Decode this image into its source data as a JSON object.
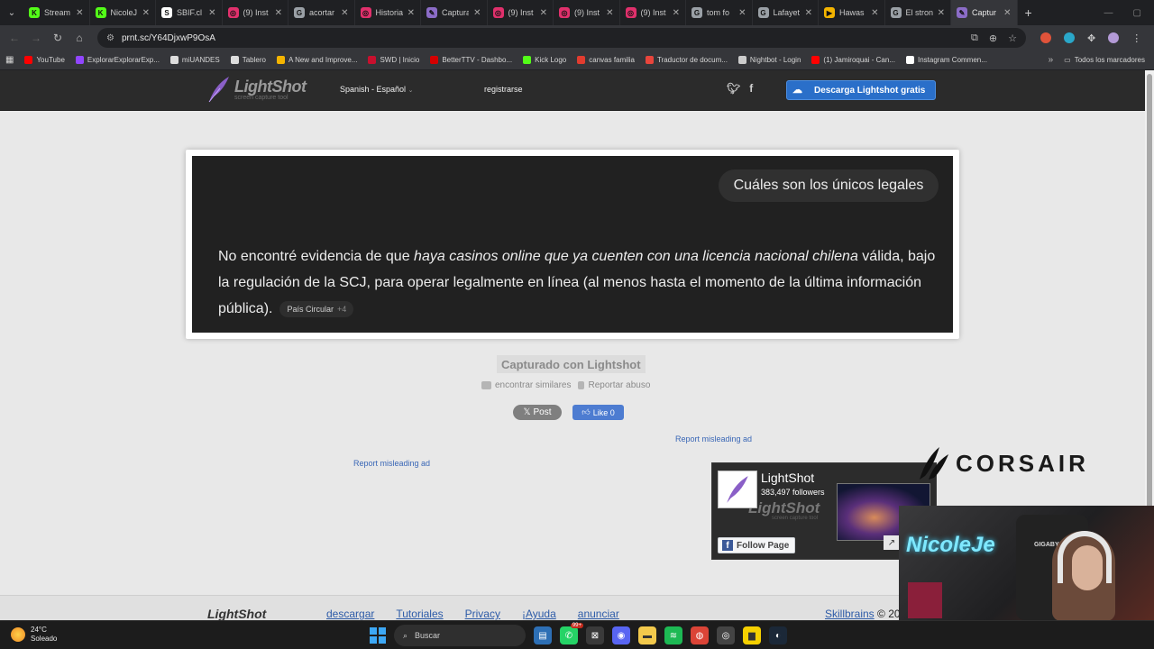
{
  "browser": {
    "tabs": [
      {
        "title": "Stream",
        "color": "#53fc18",
        "glyph": "K"
      },
      {
        "title": "NicoleJ",
        "color": "#53fc18",
        "glyph": "K"
      },
      {
        "title": "SBIF.cl",
        "color": "#ffffff",
        "glyph": "S"
      },
      {
        "title": "(9) Inst",
        "color": "#e1306c",
        "glyph": "◎"
      },
      {
        "title": "acortar",
        "color": "#9aa0a6",
        "glyph": "G"
      },
      {
        "title": "Historia",
        "color": "#e1306c",
        "glyph": "◎"
      },
      {
        "title": "Captura",
        "color": "#8b6cc7",
        "glyph": "✎"
      },
      {
        "title": "(9) Inst",
        "color": "#e1306c",
        "glyph": "◎"
      },
      {
        "title": "(9) Inst",
        "color": "#e1306c",
        "glyph": "◎"
      },
      {
        "title": "(9) Inst",
        "color": "#e1306c",
        "glyph": "◎"
      },
      {
        "title": "tom fo",
        "color": "#9aa0a6",
        "glyph": "G"
      },
      {
        "title": "Lafayet",
        "color": "#9aa0a6",
        "glyph": "G"
      },
      {
        "title": "Hawas",
        "color": "#f4b400",
        "glyph": "▶"
      },
      {
        "title": "El stron",
        "color": "#9aa0a6",
        "glyph": "G"
      },
      {
        "title": "Captur",
        "color": "#8b6cc7",
        "glyph": "✎"
      }
    ],
    "active_tab_index": 14,
    "url": "prnt.sc/Y64DjxwP9OsA",
    "bookmarks": [
      {
        "label": "YouTube",
        "color": "#ff0000"
      },
      {
        "label": "ExplorarExplorarExp...",
        "color": "#9146ff"
      },
      {
        "label": "miUANDES",
        "color": "#dddddd"
      },
      {
        "label": "Tablero",
        "color": "#dddddd"
      },
      {
        "label": "A New and Improve...",
        "color": "#f4b400"
      },
      {
        "label": "SWD | Inicio",
        "color": "#c8102e"
      },
      {
        "label": "BetterTTV - Dashbo...",
        "color": "#d50000"
      },
      {
        "label": "Kick Logo",
        "color": "#53fc18"
      },
      {
        "label": "canvas familia",
        "color": "#e13c2f"
      },
      {
        "label": "Traductor de docum...",
        "color": "#e8453c"
      },
      {
        "label": "Nightbot - Login",
        "color": "#cccccc"
      },
      {
        "label": "(1) Jamiroquai - Can...",
        "color": "#ff0000"
      },
      {
        "label": "Instagram Commen...",
        "color": "#ffffff"
      }
    ],
    "bookmarks_more": "»",
    "all_bookmarks": "Todos los marcadores"
  },
  "lightshot": {
    "logo_name": "LightShot",
    "logo_sub": "screen capture tool",
    "language": "Spanish - Español",
    "register": "registrarse",
    "download": "Descarga Lightshot gratis",
    "screenshot": {
      "question": "Cuáles son los únicos legales",
      "answer_plain_1": "No encontré evidencia de que ",
      "answer_italic": "haya casinos online que ya cuenten con una licencia nacional chilena",
      "answer_plain_2": " válida, bajo la regulación de la SCJ, para operar legalmente en línea (al menos hasta el momento de la última información pública).",
      "cite_label": "País Circular",
      "cite_more": "+4"
    },
    "captured": "Capturado con Lightshot",
    "find_similar": "encontrar similares",
    "report_abuse": "Reportar abuso",
    "post": "Post",
    "like": "Like 0",
    "report_ad_1": "Report misleading ad",
    "report_ad_2": "Report misleading ad",
    "fb": {
      "name": "LightShot",
      "followers": "383,497 followers",
      "bg_text": "LightShot",
      "bg_sub": "screen capture tool",
      "follow": "Follow Page"
    },
    "footer": {
      "logo": "LightShot",
      "links": [
        "descargar",
        "Tutoriales",
        "Privacy",
        "¡Ayuda",
        "anunciar"
      ],
      "company": "Skillbrains",
      "copyright": "© 20"
    }
  },
  "overlay": {
    "corsair": "CORSAIR",
    "neon": "NicoleJe",
    "chair_brand": "GIGABY"
  },
  "taskbar": {
    "temp": "24°C",
    "weather": "Soleado",
    "search": "Buscar",
    "badge": "99+"
  }
}
